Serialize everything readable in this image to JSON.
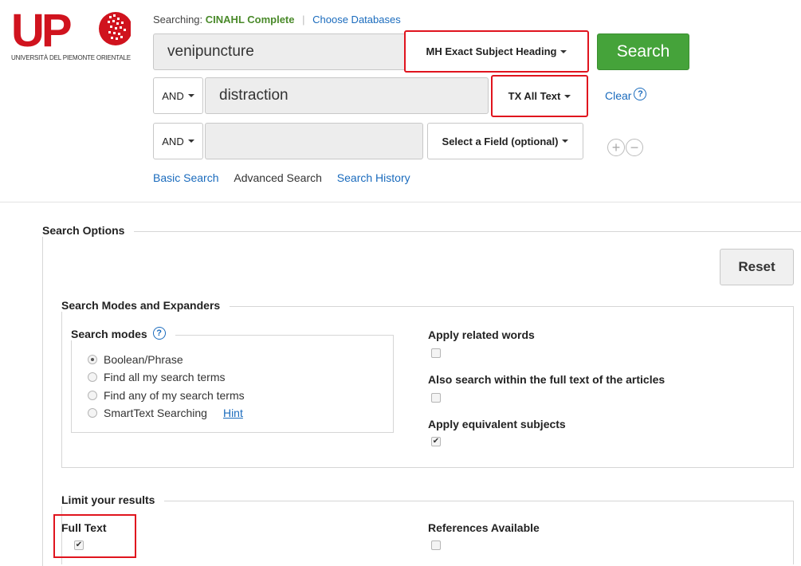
{
  "logo": {
    "text": "UP",
    "subtitle": "UNIVERSITÀ DEL PIEMONTE ORIENTALE",
    "color": "#d0131e"
  },
  "header": {
    "searching_label": "Searching:",
    "database": "CINAHL Complete",
    "choose_databases": "Choose Databases"
  },
  "rows": [
    {
      "value": "venipuncture",
      "field": "MH Exact Subject Heading"
    },
    {
      "bool": "AND",
      "value": "distraction",
      "field": "TX All Text"
    },
    {
      "bool": "AND",
      "value": "",
      "field": "Select a Field (optional)"
    }
  ],
  "search_button": "Search",
  "clear": "Clear",
  "help_glyph": "?",
  "add_glyph": "+",
  "remove_glyph": "−",
  "nav_links": {
    "basic": "Basic Search",
    "advanced": "Advanced Search",
    "history": "Search History"
  },
  "search_options": {
    "title": "Search Options",
    "reset": "Reset",
    "modes_section": {
      "title": "Search Modes and Expanders",
      "search_modes_title": "Search modes",
      "modes": [
        {
          "label": "Boolean/Phrase",
          "selected": true
        },
        {
          "label": "Find all my search terms",
          "selected": false
        },
        {
          "label": "Find any of my search terms",
          "selected": false
        },
        {
          "label": "SmartText Searching",
          "selected": false
        }
      ],
      "hint": "Hint",
      "expanders": [
        {
          "label": "Apply related words",
          "checked": false
        },
        {
          "label": "Also search within the full text of the articles",
          "checked": false
        },
        {
          "label": "Apply equivalent subjects",
          "checked": true
        }
      ]
    },
    "limits_section": {
      "title": "Limit your results",
      "limits": [
        {
          "label": "Full Text",
          "checked": true
        },
        {
          "label": "References Available",
          "checked": false
        }
      ]
    }
  },
  "colors": {
    "accent_green": "#45a33a",
    "link_blue": "#1a6bbd",
    "highlight_red": "#e0141e"
  }
}
